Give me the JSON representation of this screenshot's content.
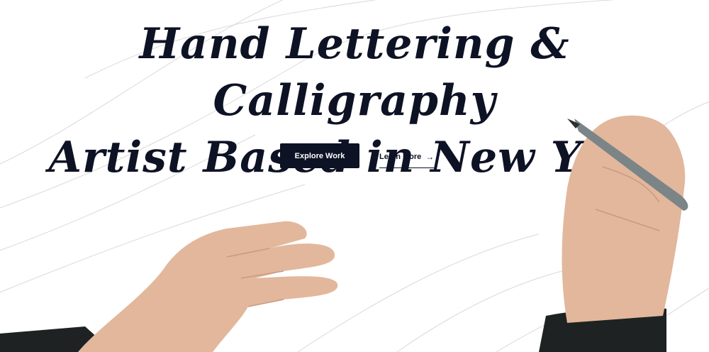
{
  "hero": {
    "title_line1": "Hand Lettering & Calligraphy",
    "title_line2": "Artist Based in New York"
  },
  "actions": {
    "explore_label": "Explore Work",
    "learn_more_label": "Learn More",
    "learn_more_icon": "arrow-right-icon"
  },
  "colors": {
    "ink": "#0d1224",
    "background": "#ffffff",
    "skin": "#e2b79c",
    "sleeve": "#1e2223",
    "pen": "#7b8588"
  }
}
